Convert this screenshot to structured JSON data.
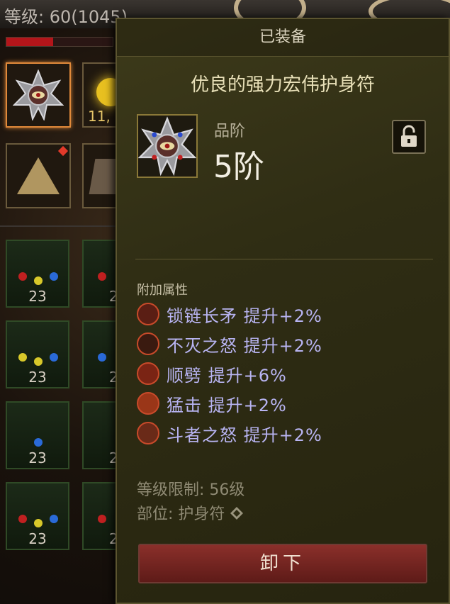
{
  "hud": {
    "level_text": "等级: 60(1045)",
    "hp_fraction": 0.44
  },
  "inventory": {
    "slot_counts": [
      "11,",
      "23",
      "23",
      "23",
      "23"
    ],
    "partial_counts": [
      "2",
      "2",
      "2",
      "2"
    ]
  },
  "tooltip": {
    "header": "已装备",
    "item_name": "优良的强力宏伟护身符",
    "tier_label": "品阶",
    "tier_value": "5阶",
    "attributes_title": "附加属性",
    "attributes": [
      "锁链长矛  提升+2%",
      "不灭之怒  提升+2%",
      "顺劈  提升+6%",
      "猛击  提升+2%",
      "斗者之怒  提升+2%"
    ],
    "level_requirement": "等级限制: 56级",
    "slot_type": "部位: 护身符",
    "unequip_label": "卸下"
  },
  "colors": {
    "accent": "#e0893a",
    "attribute_text": "#b8b4f2",
    "button": "#8a2f2a"
  },
  "icons": [
    "amulet-icon",
    "lock-icon",
    "diamond-icon",
    "skill-icon"
  ]
}
